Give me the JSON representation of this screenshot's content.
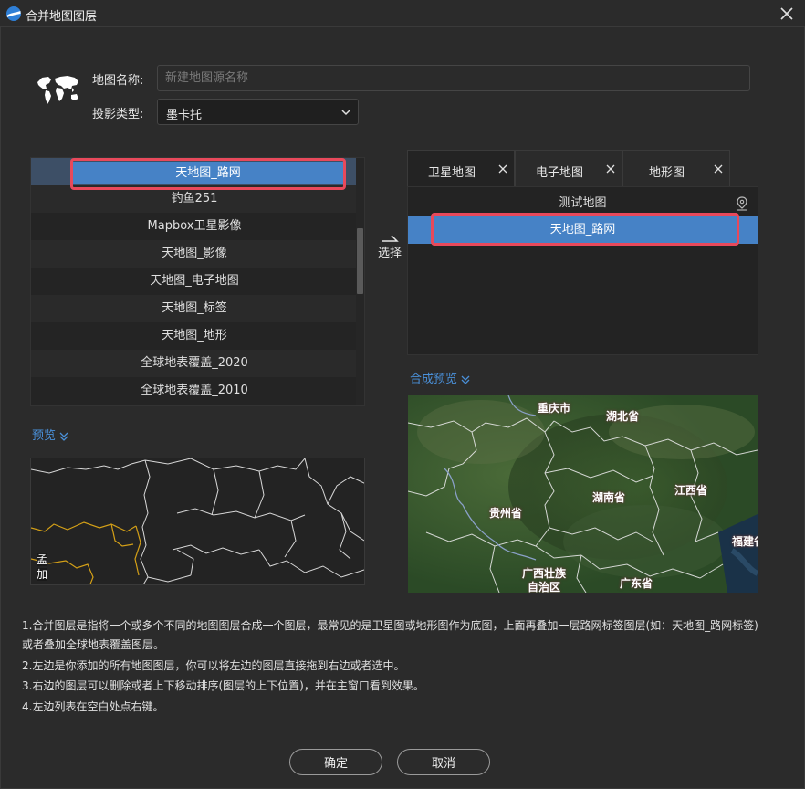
{
  "window": {
    "title": "合并地图图层"
  },
  "form": {
    "name_label": "地图名称:",
    "name_placeholder": "新建地图源名称",
    "name_value": "",
    "projection_label": "投影类型:",
    "projection_value": "墨卡托"
  },
  "left_list": {
    "items": [
      "天地图_路网",
      "钓鱼251",
      "Mapbox卫星影像",
      "天地图_影像",
      "天地图_电子地图",
      "天地图_标签",
      "天地图_地形",
      "全球地表覆盖_2020",
      "全球地表覆盖_2010"
    ],
    "selected_index": 0
  },
  "select_button": {
    "label": "选择"
  },
  "tabs": [
    {
      "label": "卫星地图",
      "active": true
    },
    {
      "label": "电子地图",
      "active": false
    },
    {
      "label": "地形图",
      "active": false
    }
  ],
  "right_list": {
    "items": [
      "测试地图",
      "天地图_路网"
    ],
    "selected_index": 1
  },
  "preview_left": {
    "label": "预览",
    "map_labels": [
      "孟",
      "加"
    ]
  },
  "preview_right": {
    "label": "合成预览",
    "map_labels": [
      "重庆市",
      "湖北省",
      "贵州省",
      "湖南省",
      "江西省",
      "广西壮族",
      "自治区",
      "广东省",
      "福建省"
    ]
  },
  "description": [
    "1.合并图层是指将一个或多个不同的地图图层合成一个图层，最常见的是卫星图或地形图作为底图，上面再叠加一层路网标签图层(如：天地图_路网标签)",
    "或者叠加全球地表覆盖图层。",
    "2.左边是你添加的所有地图图层，你可以将左边的图层直接拖到右边或者选中。",
    "3.右边的图层可以删除或者上下移动排序(图层的上下位置)，并在主窗口看到效果。",
    "4.左边列表在空白处点右键。"
  ],
  "buttons": {
    "ok": "确定",
    "cancel": "取消"
  },
  "colors": {
    "accent": "#4682c6",
    "highlight": "#e8495b",
    "link": "#4a90d9",
    "background": "#2b2b2b"
  }
}
